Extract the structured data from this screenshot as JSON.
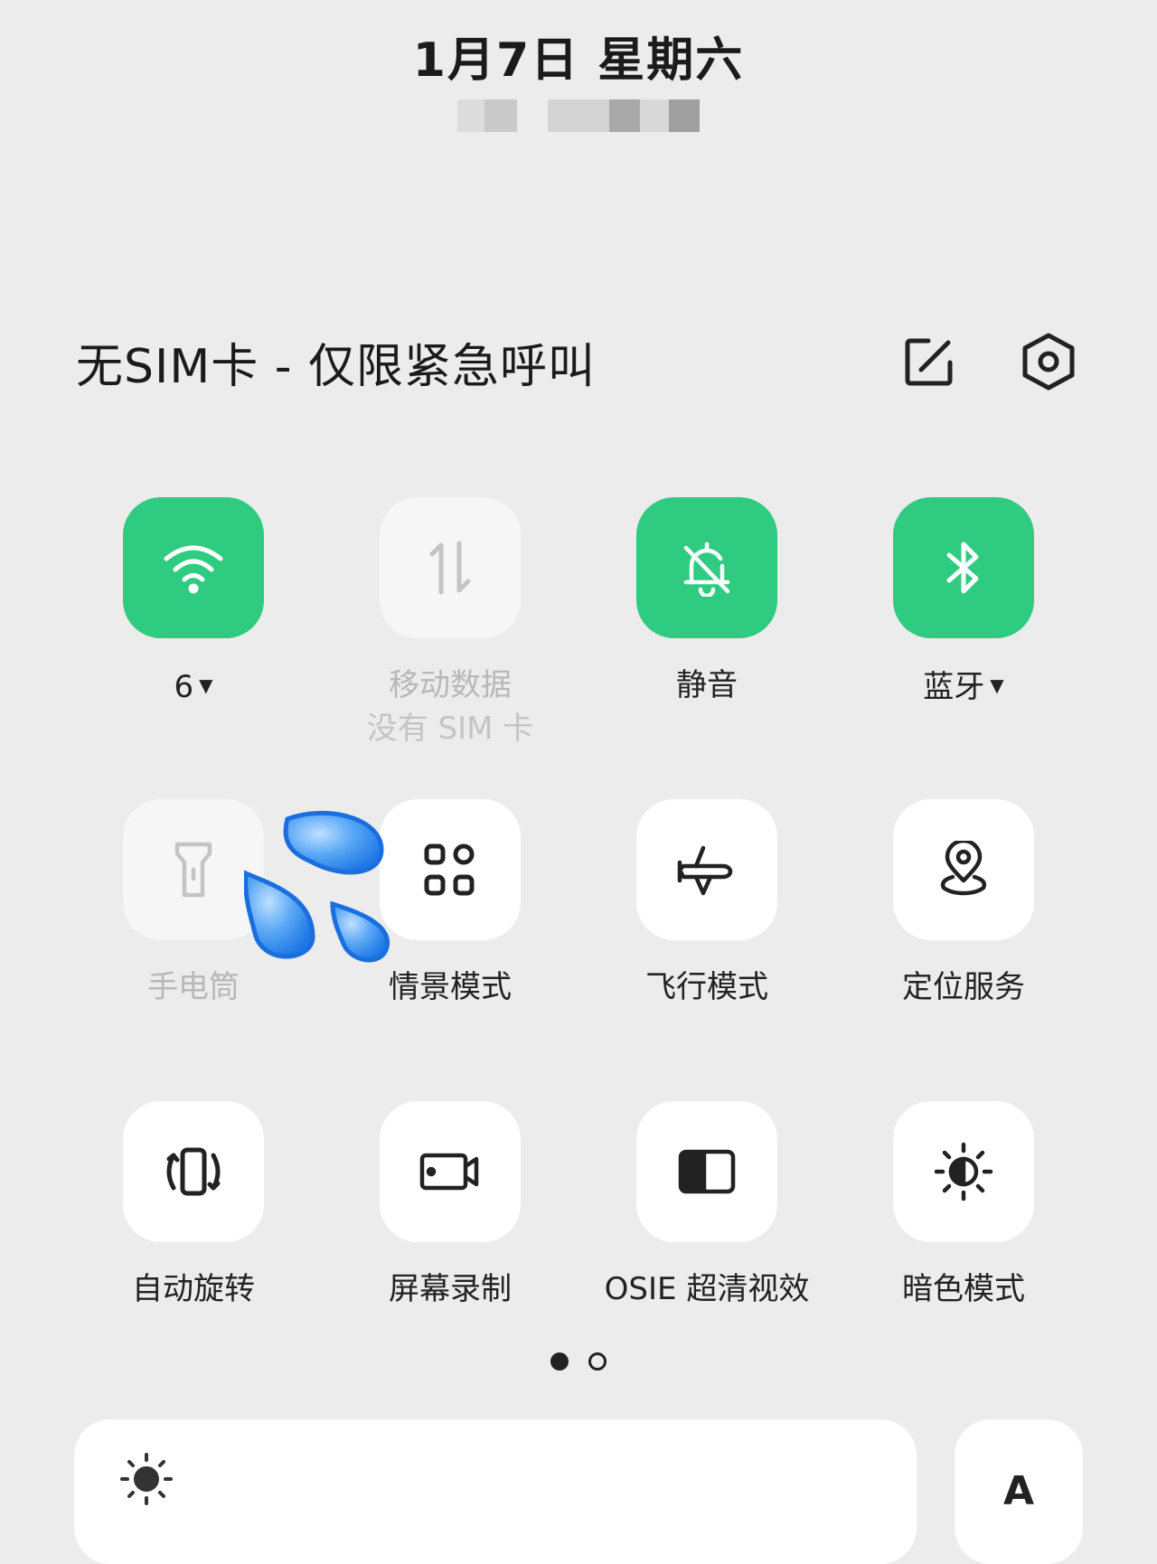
{
  "header": {
    "date": "1月7日  星期六"
  },
  "status": {
    "carrier_text": "无SIM卡 - 仅限紧急呼叫",
    "edit_icon": "edit-icon",
    "settings_icon": "settings-icon"
  },
  "tiles": [
    {
      "label": "6",
      "state": "on",
      "icon": "wifi-icon",
      "dropdown": true
    },
    {
      "label": "移动数据",
      "sub": "没有 SIM 卡",
      "state": "disabled",
      "icon": "mobile-data-icon"
    },
    {
      "label": "静音",
      "state": "on",
      "icon": "bell-off-icon"
    },
    {
      "label": "蓝牙",
      "state": "on",
      "icon": "bluetooth-icon",
      "dropdown": true
    },
    {
      "label": "手电筒",
      "state": "disabled",
      "icon": "flashlight-icon"
    },
    {
      "label": "情景模式",
      "state": "off",
      "icon": "grid-icon"
    },
    {
      "label": "飞行模式",
      "state": "off",
      "icon": "airplane-icon"
    },
    {
      "label": "定位服务",
      "state": "off",
      "icon": "location-icon"
    },
    {
      "label": "自动旋转",
      "state": "off",
      "icon": "rotate-icon"
    },
    {
      "label": "屏幕录制",
      "state": "off",
      "icon": "screen-record-icon"
    },
    {
      "label": "OSIE 超清视效",
      "state": "off",
      "icon": "osie-icon"
    },
    {
      "label": "暗色模式",
      "state": "off",
      "icon": "dark-mode-icon"
    }
  ],
  "pager": {
    "current": 1,
    "total": 2
  },
  "brightness": {
    "icon": "brightness-icon",
    "auto_label": "A"
  },
  "colors": {
    "accent": "#2fcb80",
    "background": "#ececec",
    "tile": "#ffffff"
  }
}
